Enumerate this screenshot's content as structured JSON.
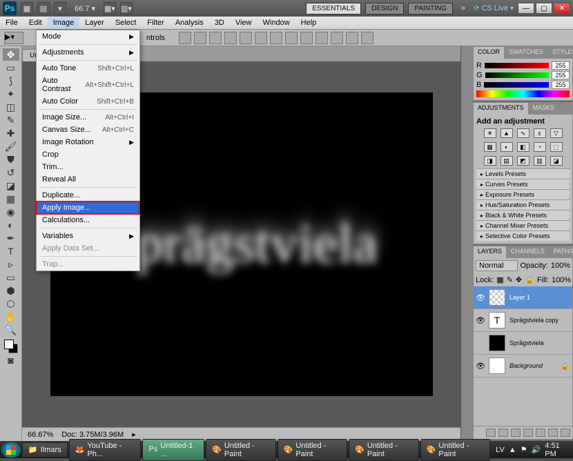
{
  "titlebar": {
    "logo": "Ps",
    "zoom": "66.7",
    "workspace_essentials": "ESSENTIALS",
    "workspace_design": "DESIGN",
    "workspace_painting": "PAINTING",
    "cslive": "CS Live"
  },
  "menubar": {
    "file": "File",
    "edit": "Edit",
    "image": "Image",
    "layer": "Layer",
    "select": "Select",
    "filter": "Filter",
    "analysis": "Analysis",
    "threed": "3D",
    "view": "View",
    "window": "Window",
    "help": "Help"
  },
  "optbar": {
    "ntrols": "ntrols"
  },
  "dropdown": {
    "mode": "Mode",
    "adjustments": "Adjustments",
    "auto_tone": "Auto Tone",
    "auto_tone_key": "Shift+Ctrl+L",
    "auto_contrast": "Auto Contrast",
    "auto_contrast_key": "Alt+Shift+Ctrl+L",
    "auto_color": "Auto Color",
    "auto_color_key": "Shift+Ctrl+B",
    "image_size": "Image Size...",
    "image_size_key": "Alt+Ctrl+I",
    "canvas_size": "Canvas Size...",
    "canvas_size_key": "Alt+Ctrl+C",
    "image_rotation": "Image Rotation",
    "crop": "Crop",
    "trim": "Trim...",
    "reveal_all": "Reveal All",
    "duplicate": "Duplicate...",
    "apply_image": "Apply Image...",
    "calculations": "Calculations...",
    "variables": "Variables",
    "apply_data_set": "Apply Data Set...",
    "trap": "Trap..."
  },
  "document": {
    "tab": "Untit",
    "canvas_text": "Sprāgstviela"
  },
  "statusbar": {
    "zoom": "66.67%",
    "doc_label": "Doc:",
    "doc_size": "3.75M/3.96M"
  },
  "panels": {
    "color_tab": "COLOR",
    "swatches_tab": "SWATCHES",
    "styles_tab": "STYLES",
    "R": "R",
    "G": "G",
    "B": "B",
    "rgb_val": "255",
    "adjustments_tab": "ADJUSTMENTS",
    "masks_tab": "MASKS",
    "add_adj": "Add an adjustment",
    "presets": {
      "levels": "Levels Presets",
      "curves": "Curves Presets",
      "exposure": "Exposure Presets",
      "hue": "Hue/Saturation Presets",
      "bw": "Black & White Presets",
      "mixer": "Channel Mixer Presets",
      "selective": "Selective Color Presets"
    },
    "layers_tab": "LAYERS",
    "channels_tab": "CHANNELS",
    "paths_tab": "PATHS",
    "blend": "Normal",
    "opacity_label": "Opacity:",
    "opacity": "100%",
    "lock_label": "Lock:",
    "fill_label": "Fill:",
    "fill": "100%",
    "items": [
      {
        "name": "Layer 1"
      },
      {
        "name": "Sprāgstviela copy"
      },
      {
        "name": "Sprāgstviela"
      },
      {
        "name": "Background"
      }
    ]
  },
  "taskbar": {
    "item1": "Ilmars",
    "item2": "YouTube - Ph...",
    "item3": "Untitled-1 ...",
    "item4": "Untitled - Paint",
    "item5": "Untitled - Paint",
    "item6": "Untitled - Paint",
    "item7": "Untitled - Paint",
    "lang": "LV",
    "time": "4:51 PM"
  }
}
